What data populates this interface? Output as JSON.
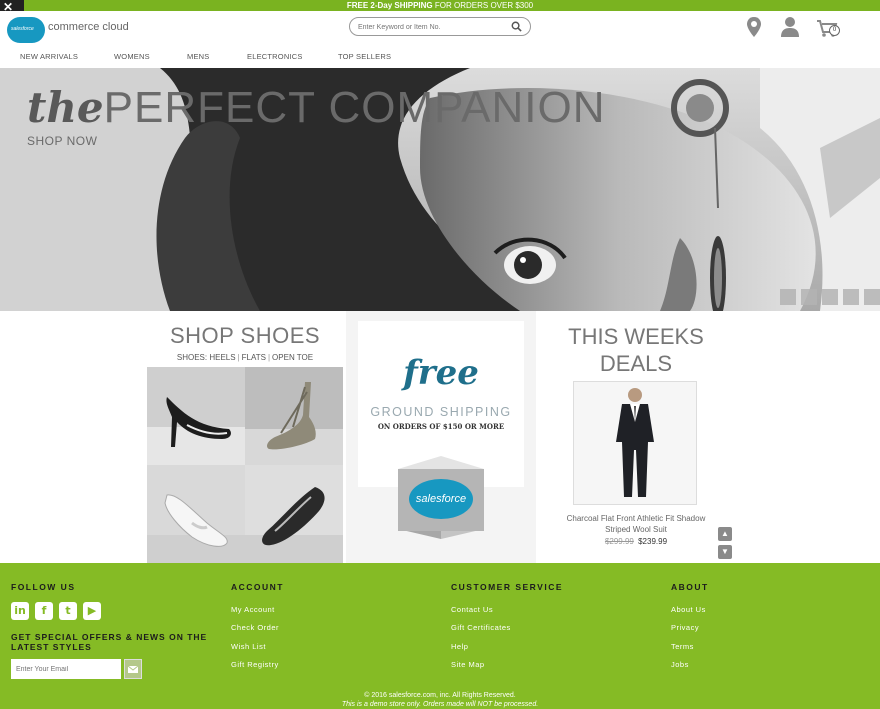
{
  "promo": {
    "bold": "FREE 2-Day SHIPPING",
    "rest": " FOR ORDERS OVER $300"
  },
  "header": {
    "logo_badge": "salesforce",
    "logo_text": "commerce cloud",
    "search_placeholder": "Enter Keyword or Item No.",
    "cart_count": "0"
  },
  "nav": [
    "NEW ARRIVALS",
    "WOMENS",
    "MENS",
    "ELECTRONICS",
    "TOP SELLERS"
  ],
  "hero": {
    "title_the": "the",
    "title_rest": "PERFECT COMPANION",
    "cta": "SHOP NOW"
  },
  "shoes": {
    "title": "SHOP SHOES",
    "prefix": "SHOES:",
    "links": [
      "HEELS",
      "FLATS",
      "OPEN TOE"
    ]
  },
  "shipping": {
    "free": "free",
    "ground": "GROUND SHIPPING",
    "orders": "ON ORDERS OF $150 OR MORE",
    "box_logo": "salesforce"
  },
  "deals": {
    "title_line1": "THIS WEEKS",
    "title_line2": "DEALS",
    "product_name": "Charcoal Flat Front Athletic Fit Shadow Striped Wool Suit",
    "old_price": "$299.99",
    "new_price": "$239.99"
  },
  "footer": {
    "follow": "FOLLOW US",
    "offers": "GET SPECIAL OFFERS & NEWS ON THE LATEST STYLES",
    "email_placeholder": "Enter Your Email",
    "account": {
      "title": "ACCOUNT",
      "links": [
        "My Account",
        "Check Order",
        "Wish List",
        "Gift Registry"
      ]
    },
    "service": {
      "title": "CUSTOMER SERVICE",
      "links": [
        "Contact Us",
        "Gift Certificates",
        "Help",
        "Site Map"
      ]
    },
    "about": {
      "title": "ABOUT",
      "links": [
        "About Us",
        "Privacy",
        "Terms",
        "Jobs"
      ]
    },
    "copyright": "© 2016 salesforce.com, inc. All Rights Reserved.",
    "demo_note": "This is a demo store only. Orders made will NOT be processed."
  },
  "colors": {
    "brand_green": "#85bb25",
    "promo_green": "#7ab320",
    "salesforce_blue": "#1798c1"
  }
}
